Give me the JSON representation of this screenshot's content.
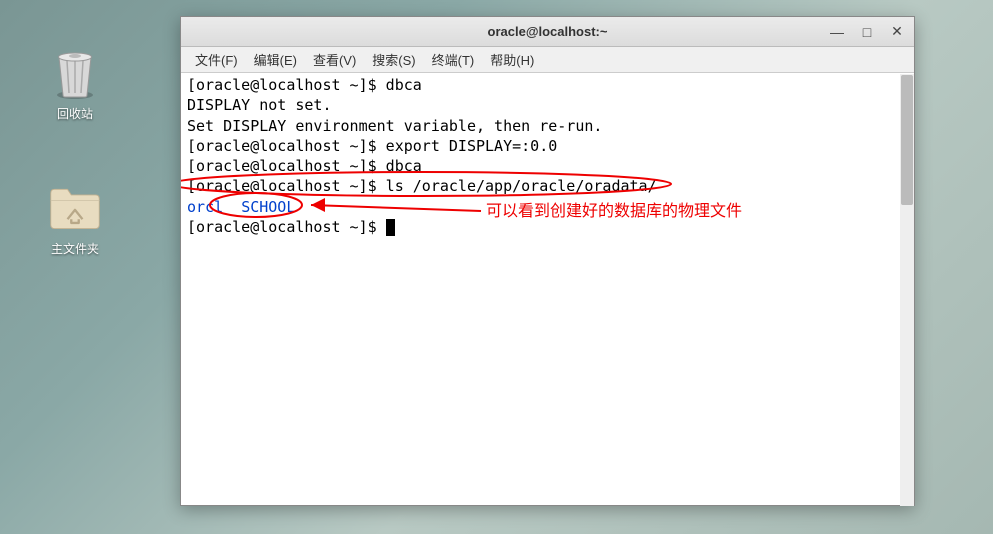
{
  "desktop": {
    "trash_label": "回收站",
    "home_folder_label": "主文件夹"
  },
  "window": {
    "title": "oracle@localhost:~",
    "controls": {
      "minimize": "—",
      "maximize": "□",
      "close": "✕"
    }
  },
  "menubar": {
    "items": [
      "文件(F)",
      "编辑(E)",
      "查看(V)",
      "搜索(S)",
      "终端(T)",
      "帮助(H)"
    ]
  },
  "terminal": {
    "lines": [
      {
        "text": "[oracle@localhost ~]$ dbca"
      },
      {
        "text": "DISPLAY not set."
      },
      {
        "text": "Set DISPLAY environment variable, then re-run."
      },
      {
        "text": "[oracle@localhost ~]$ export DISPLAY=:0.0"
      },
      {
        "text": "[oracle@localhost ~]$ dbca"
      },
      {
        "text": "[oracle@localhost ~]$ ls /oracle/app/oracle/oradata/"
      },
      {
        "prefix": "orcl  ",
        "blue": "SCHOOL"
      },
      {
        "text": "[oracle@localhost ~]$ ",
        "cursor": true
      }
    ]
  },
  "annotation": {
    "text": "可以看到创建好的数据库的物理文件"
  }
}
